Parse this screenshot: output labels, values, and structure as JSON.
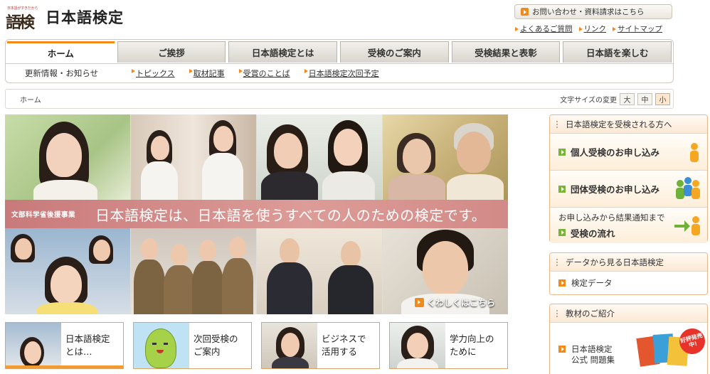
{
  "header": {
    "logo_tagline": "日本語がすきだから",
    "logo_mark": "語検",
    "site_title": "日本語検定",
    "contact_label": "お問い合わせ・資料請求はこちら",
    "util_links": [
      "よくあるご質問",
      "リンク",
      "サイトマップ"
    ]
  },
  "nav": {
    "tabs": [
      "ホーム",
      "ご挨拶",
      "日本語検定とは",
      "受検のご案内",
      "受検結果と表彰",
      "日本語を楽しむ"
    ],
    "active_tab": "ホーム",
    "sub_label": "更新情報・お知らせ",
    "sub_links": [
      "トピックス",
      "取材記事",
      "受賞のことば",
      "日本語検定次回予定"
    ]
  },
  "breadcrumb": {
    "current": "ホーム",
    "font_size_label": "文字サイズの変更",
    "font_sizes": [
      "大",
      "中",
      "小"
    ],
    "selected_size": "小"
  },
  "hero": {
    "tag": "文部科学省後援事業",
    "slogan": "日本語検定は、日本語を使うすべての人のための検定です。",
    "more_label": "くわしくはこちら"
  },
  "banners": [
    {
      "text": "日本語検定\nとは…"
    },
    {
      "text": "次回受検の\nご案内"
    },
    {
      "text": "ビジネスで\n活用する"
    },
    {
      "text": "学力向上の\nために"
    }
  ],
  "sidebar": {
    "apply": {
      "title": "日本語検定を受検される方へ",
      "items": [
        "個人受検のお申し込み",
        "団体受検のお申し込み"
      ],
      "flow_caption": "お申し込みから結果通知まで",
      "flow_label": "受検の流れ"
    },
    "data": {
      "title": "データから見る日本語検定",
      "item": "検定データ"
    },
    "materials": {
      "title": "教材のご紹介",
      "item_line1": "日本語検定",
      "item_line2": "公式 問題集",
      "badge": "好評発売中!"
    }
  },
  "colors": {
    "accent": "#f08a1d",
    "green_icon": "#7ab23a",
    "band": "#d99592"
  }
}
